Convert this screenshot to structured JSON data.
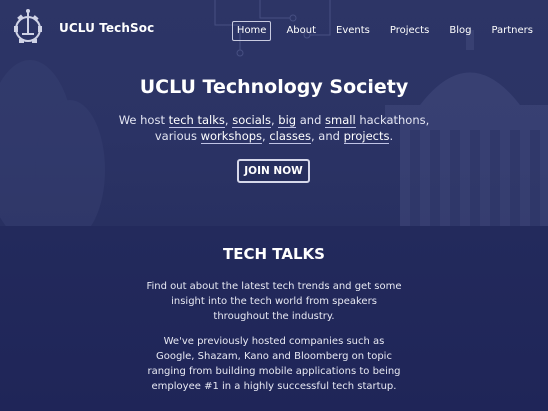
{
  "brand": {
    "name": "UCLU TechSoc"
  },
  "nav": {
    "items": [
      {
        "label": "Home",
        "active": true
      },
      {
        "label": "About"
      },
      {
        "label": "Events"
      },
      {
        "label": "Projects"
      },
      {
        "label": "Blog"
      },
      {
        "label": "Partners"
      }
    ]
  },
  "hero": {
    "title": "UCLU Technology Society",
    "desc": {
      "t1": "We host ",
      "l1": "tech talks",
      "t2": ", ",
      "l2": "socials",
      "t3": ", ",
      "l3": "big",
      "t4": " and ",
      "l4": "small",
      "t5": " hackathons, various ",
      "l5": "workshops",
      "t6": ", ",
      "l6": "classes",
      "t7": ", and ",
      "l7": "projects",
      "t8": "."
    },
    "cta": "JOIN NOW"
  },
  "section": {
    "title": "TECH TALKS",
    "p1": "Find out about the latest tech trends and get some insight into the tech world from speakers throughout the industry.",
    "p2": "We've previously hosted companies such as Google, Shazam, Kano and Bloomberg on topic ranging from building mobile applications to being employee #1 in a highly successful tech startup."
  },
  "colors": {
    "background": "#1e2457",
    "hero_overlay": "#2b3365",
    "text": "#ffffff"
  },
  "icons": {
    "logo": "circuit-gear-logo-icon"
  }
}
